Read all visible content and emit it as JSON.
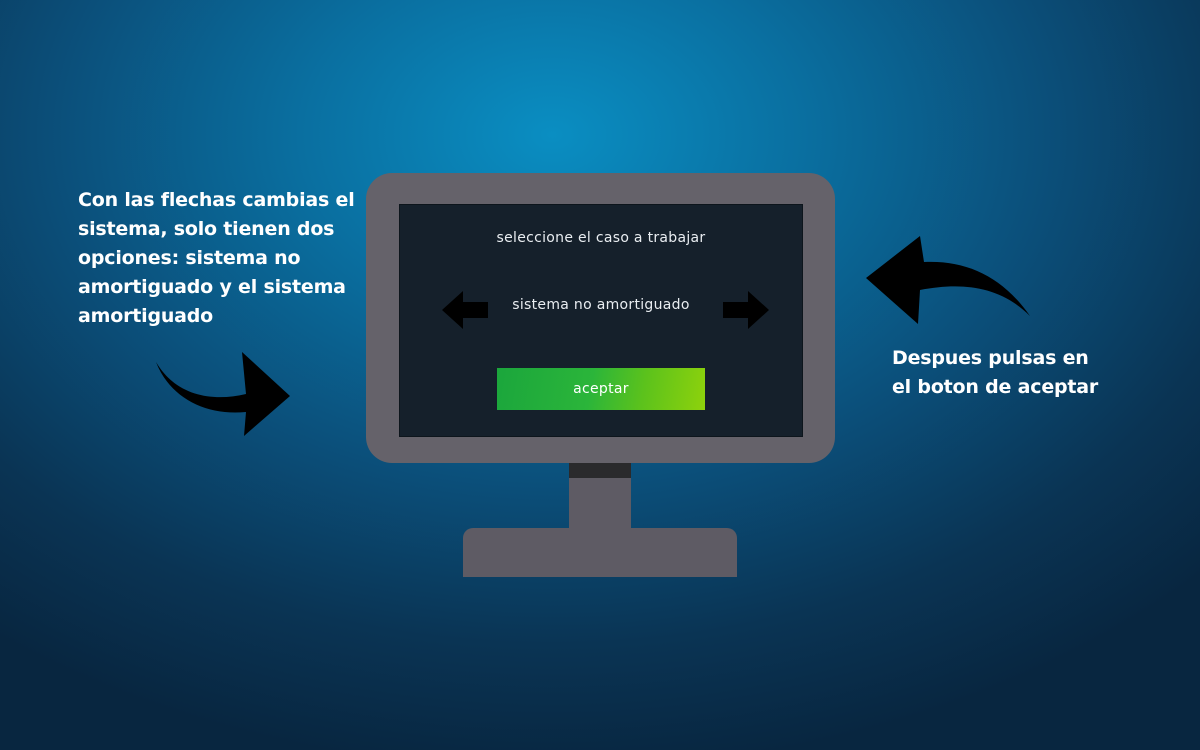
{
  "annotations": {
    "left_note_lines": [
      "Con las flechas cambias el",
      "sistema, solo tienen dos",
      "opciones: sistema no",
      "amortiguado y el sistema",
      "amortiguado"
    ],
    "right_note_lines": [
      "Despues pulsas en",
      "el boton de aceptar"
    ]
  },
  "screen": {
    "title": "seleccione el caso a trabajar",
    "selected_option": "sistema no amortiguado",
    "accept_label": "aceptar"
  },
  "icons": {
    "left_annotation": "curved-arrow-right-icon",
    "right_annotation": "curved-arrow-left-icon",
    "prev": "arrow-left-icon",
    "next": "arrow-right-icon"
  },
  "colors": {
    "background": "#0a6fa0",
    "monitor_frame": "#65626a",
    "screen": "#15202b",
    "accept_start": "#1ba63c",
    "accept_end": "#8ed20c"
  }
}
